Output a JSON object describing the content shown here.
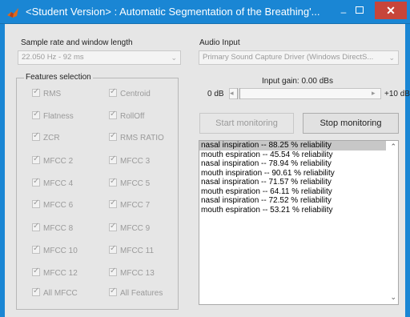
{
  "window": {
    "title": "<Student Version> : Automatic Segmentation of the Breathing'...",
    "minimize": "–",
    "close": "✕"
  },
  "sample_rate": {
    "label": "Sample rate and window length",
    "value": "22.050 Hz - 92 ms"
  },
  "audio_input": {
    "label": "Audio Input",
    "value": "Primary Sound Capture Driver (Windows DirectS..."
  },
  "features": {
    "title": "Features selection",
    "left": [
      "RMS",
      "Flatness",
      "ZCR",
      "MFCC 2",
      "MFCC 4",
      "MFCC 6",
      "MFCC 8",
      "MFCC 10",
      "MFCC 12",
      "All MFCC"
    ],
    "right": [
      "Centroid",
      "RollOff",
      "RMS RATIO",
      "MFCC 3",
      "MFCC 5",
      "MFCC 7",
      "MFCC 9",
      "MFCC 11",
      "MFCC 13",
      "All Features"
    ]
  },
  "gain": {
    "label": "Input gain:  0.00 dBs",
    "min_label": "0 dB",
    "max_label": "+10 dB",
    "left_arrow": "◂",
    "right_arrow": "▸"
  },
  "buttons": {
    "start": "Start monitoring",
    "stop": "Stop monitoring"
  },
  "results": {
    "items": [
      "nasal inspiration  --  88.25 % reliability",
      "mouth espiration  --  45.54 % reliability",
      "nasal inspiration  --  78.94 % reliability",
      "mouth inspiration  --  90.61 % reliability",
      "nasal inspiration  --  71.57 % reliability",
      "mouth espiration  --  64.11 % reliability",
      "nasal inspiration  --  72.52 % reliability",
      "mouth espiration  --  53.21 % reliability"
    ],
    "selected_index": 0
  },
  "colors": {
    "titlebar": "#1a86d4",
    "close": "#c7453a",
    "selection": "#c7c7c7"
  }
}
